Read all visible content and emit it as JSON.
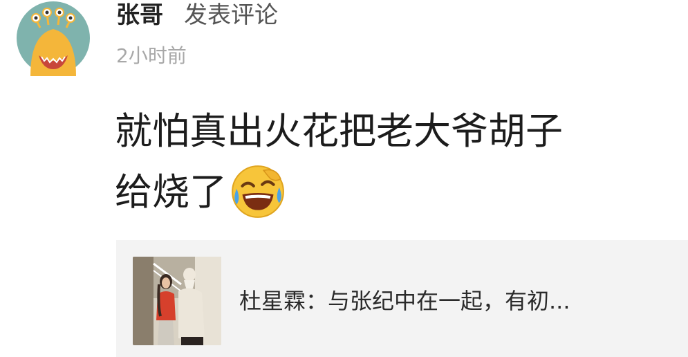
{
  "post": {
    "username": "张哥",
    "action": "发表评论",
    "timestamp": "2小时前",
    "comment_lines": [
      "就怕真出火花把老大爷胡子",
      "给烧了"
    ],
    "emoji": "laughing-crying-emoji"
  },
  "shared_card": {
    "title": "杜星霖：与张纪中在一起，有初..."
  },
  "colors": {
    "avatar_bg": "#7fb3ad",
    "avatar_face": "#f4b63a",
    "card_bg": "#f3f3f3"
  }
}
